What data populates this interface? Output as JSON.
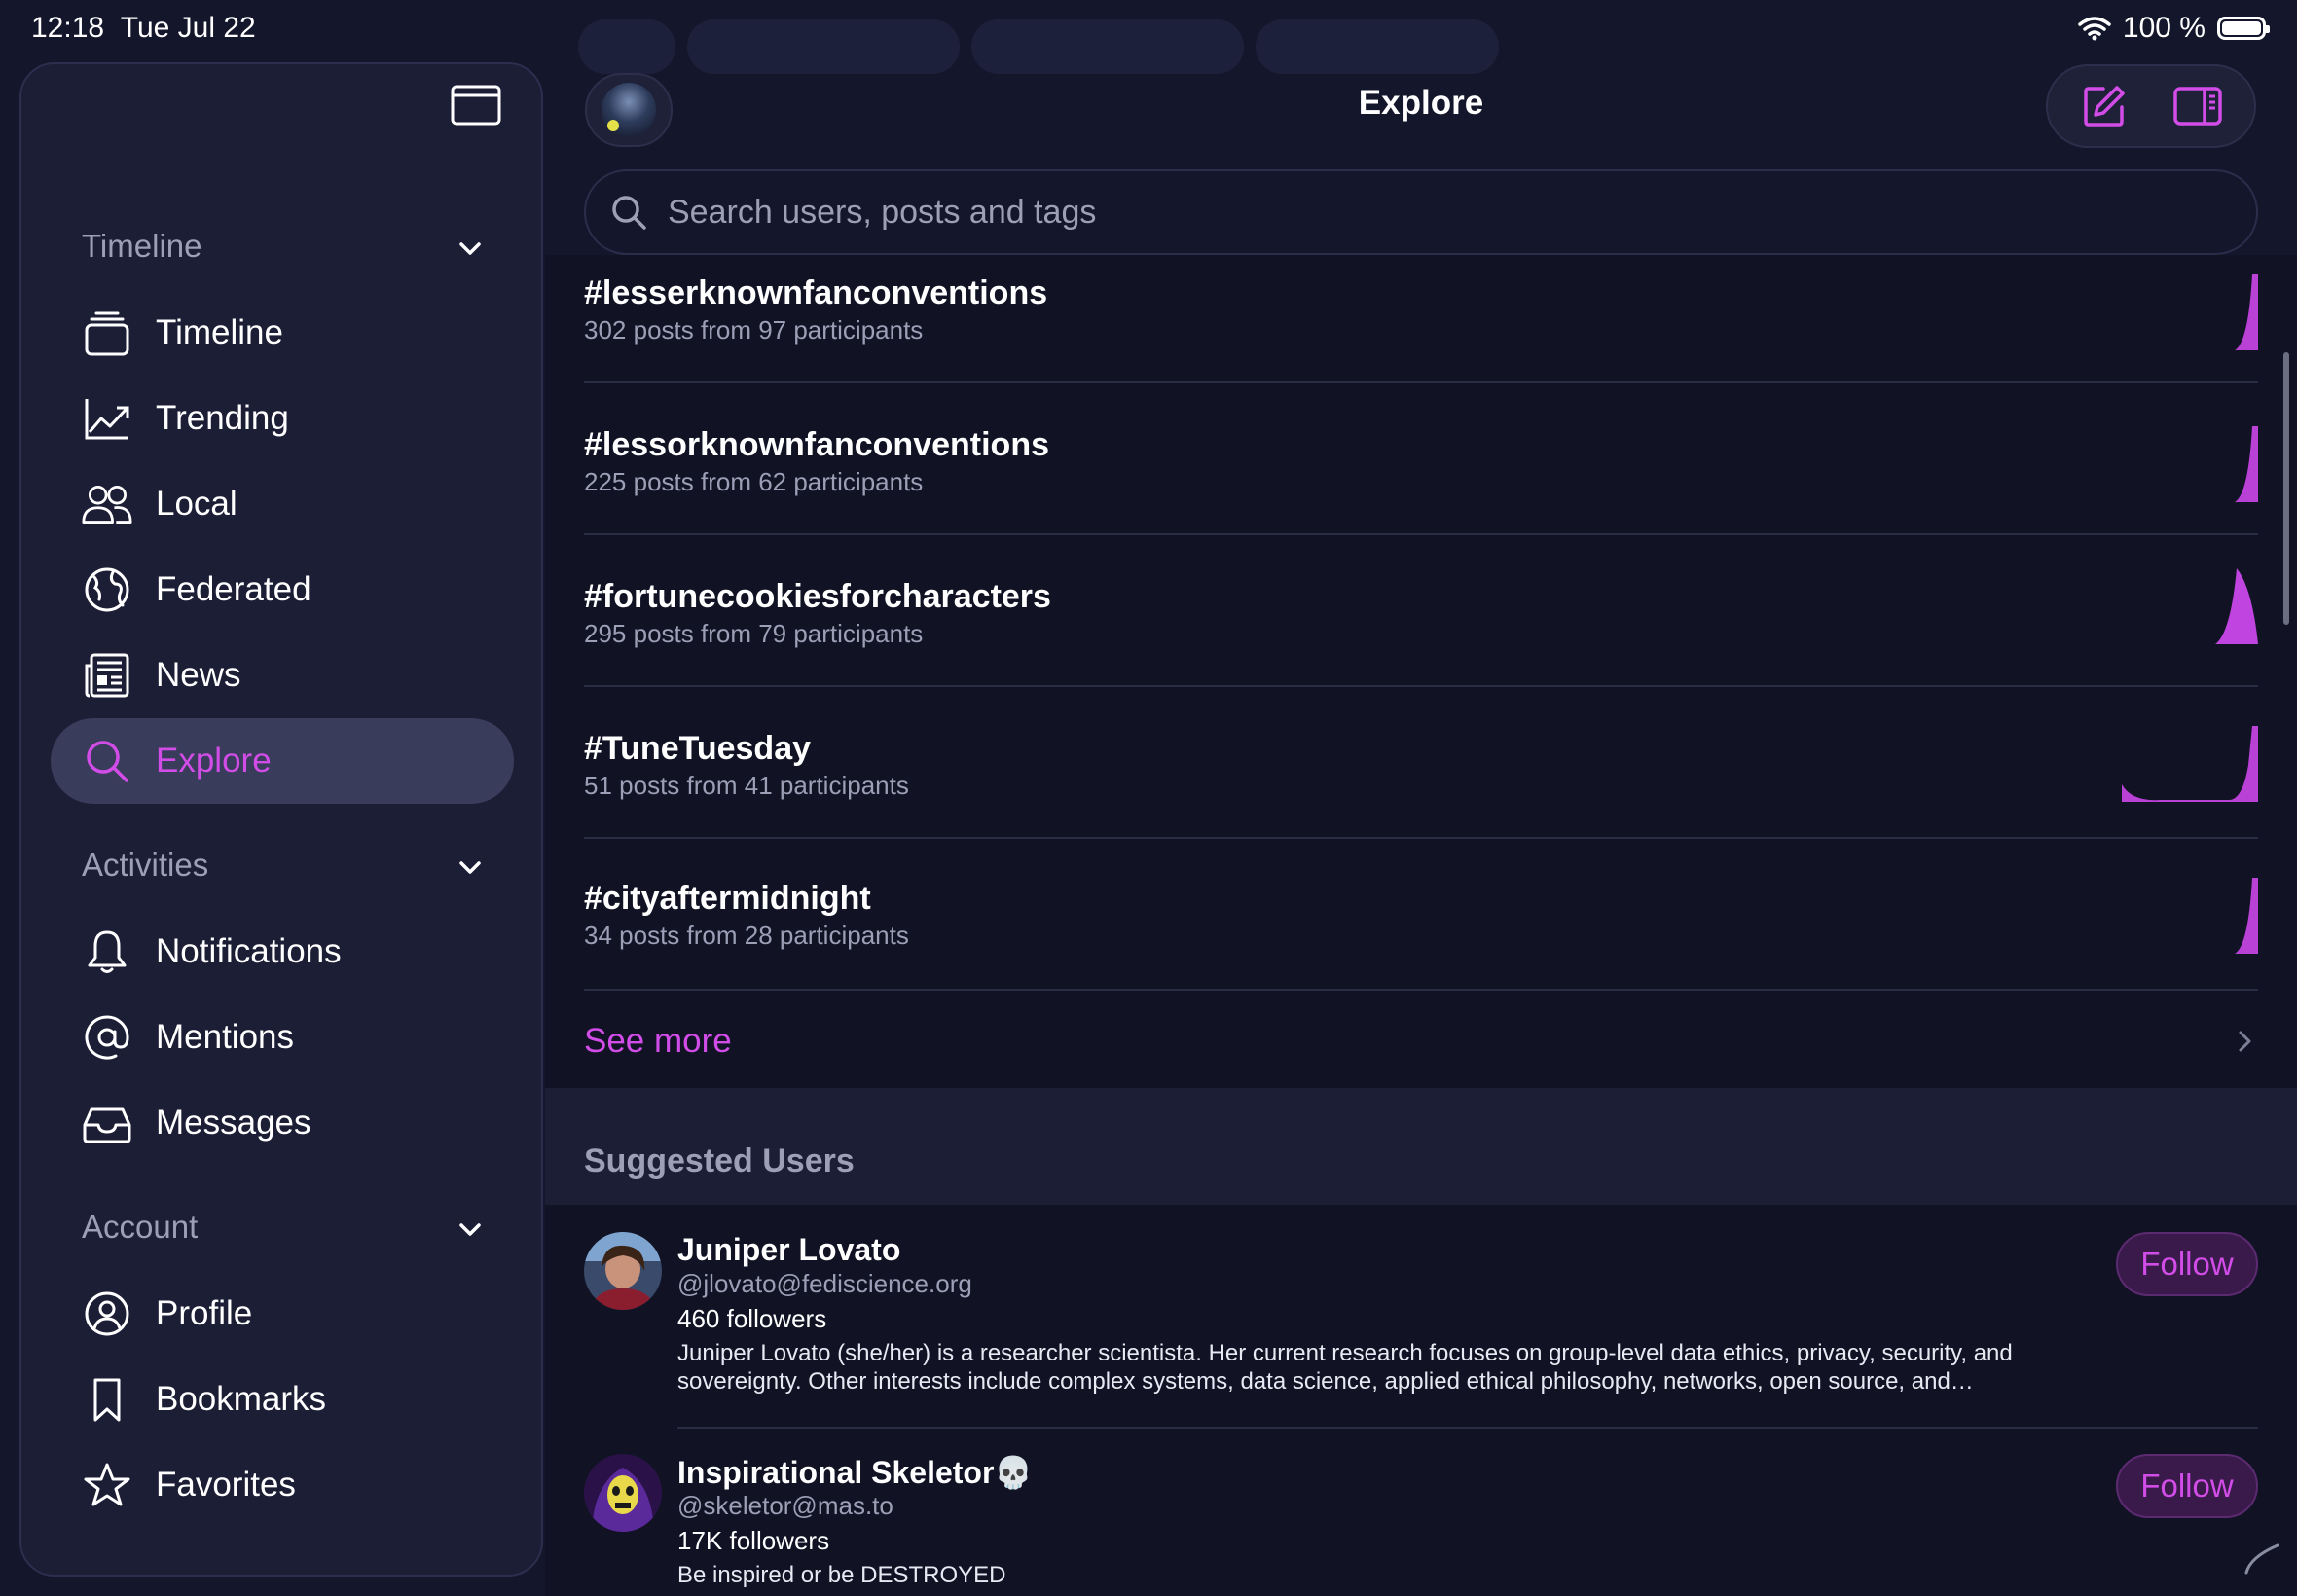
{
  "status": {
    "time": "12:18",
    "date": "Tue Jul 22",
    "battery": "100 %"
  },
  "sidebar": {
    "sections": [
      {
        "title": "Timeline",
        "items": [
          {
            "label": "Timeline",
            "icon": "timeline-stack-icon"
          },
          {
            "label": "Trending",
            "icon": "trending-chart-icon"
          },
          {
            "label": "Local",
            "icon": "people-icon"
          },
          {
            "label": "Federated",
            "icon": "globe-icon"
          },
          {
            "label": "News",
            "icon": "newspaper-icon"
          },
          {
            "label": "Explore",
            "icon": "search-icon",
            "active": true
          }
        ]
      },
      {
        "title": "Activities",
        "items": [
          {
            "label": "Notifications",
            "icon": "bell-icon"
          },
          {
            "label": "Mentions",
            "icon": "at-sign-icon"
          },
          {
            "label": "Messages",
            "icon": "inbox-icon"
          }
        ]
      },
      {
        "title": "Account",
        "items": [
          {
            "label": "Profile",
            "icon": "person-circle-icon"
          },
          {
            "label": "Bookmarks",
            "icon": "bookmark-icon"
          },
          {
            "label": "Favorites",
            "icon": "star-icon"
          }
        ]
      }
    ]
  },
  "header": {
    "title": "Explore"
  },
  "search": {
    "placeholder": "Search users, posts and tags"
  },
  "tags": [
    {
      "name": "#lesserknownfanconventions",
      "meta": "302 posts from 97 participants"
    },
    {
      "name": "#lessorknownfanconventions",
      "meta": "225 posts from 62 participants"
    },
    {
      "name": "#fortunecookiesforcharacters",
      "meta": "295 posts from 79 participants"
    },
    {
      "name": "#TuneTuesday",
      "meta": "51 posts from 41 participants"
    },
    {
      "name": "#cityaftermidnight",
      "meta": "34 posts from 28 participants"
    }
  ],
  "see_more": "See more",
  "suggested": {
    "title": "Suggested Users",
    "users": [
      {
        "name": "Juniper Lovato",
        "handle": "@jlovato@fediscience.org",
        "followers": "460 followers",
        "bio": "Juniper Lovato (she/her) is a researcher scientista. Her current research focuses on group-level data ethics, privacy, security, and sovereignty. Other interests include complex systems, data science, applied ethical philosophy, networks, open source, and…",
        "follow": "Follow"
      },
      {
        "name": "Inspirational Skeletor💀",
        "handle": "@skeletor@mas.to",
        "followers": "17K followers",
        "bio": "Be inspired or be DESTROYED",
        "follow": "Follow"
      }
    ]
  },
  "colors": {
    "accent": "#d24de8",
    "background": "#14162b",
    "panel": "#111325",
    "sidebar": "#1c1e36"
  }
}
